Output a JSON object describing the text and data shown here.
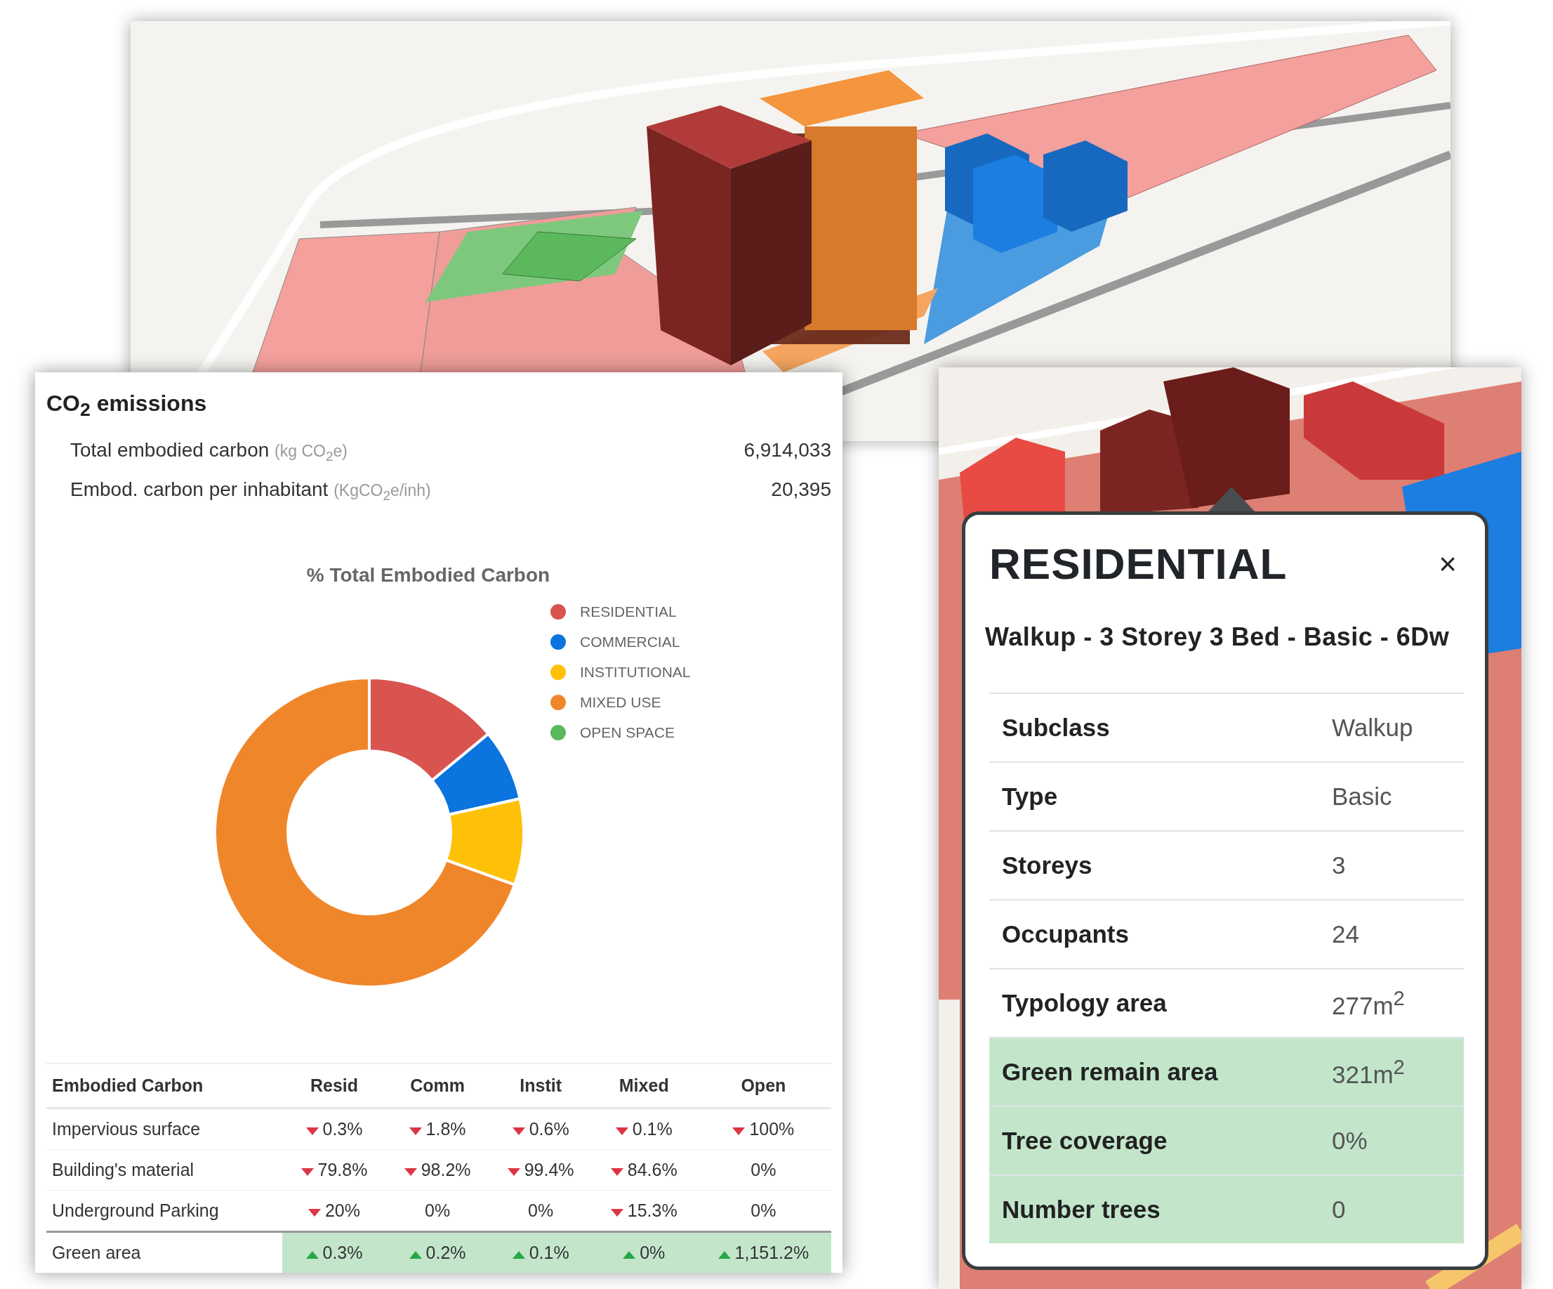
{
  "emissions_panel": {
    "title": "CO$_{2}$ emissions",
    "metrics": [
      {
        "label": "Total embodied carbon",
        "unit": "(kg CO$_{2}$e)",
        "value": "6,914,033"
      },
      {
        "label": "Embod. carbon per inhabitant",
        "unit": "(KgCO$_{2}$e/inh)",
        "value": "20,395"
      }
    ],
    "chart_title": "% Total Embodied Carbon",
    "legend": [
      {
        "label": "RESIDENTIAL",
        "color": "#d9534f"
      },
      {
        "label": "COMMERCIAL",
        "color": "#0b74de"
      },
      {
        "label": "INSTITUTIONAL",
        "color": "#ffc107"
      },
      {
        "label": "MIXED USE",
        "color": "#f0862a"
      },
      {
        "label": "OPEN SPACE",
        "color": "#5cb85c"
      }
    ],
    "table": {
      "columns": [
        "Embodied Carbon",
        "Resid",
        "Comm",
        "Instit",
        "Mixed",
        "Open"
      ],
      "rows": [
        {
          "highlight": false,
          "cells": [
            {
              "text": "Impervious surface"
            },
            {
              "text": "0.3%",
              "kind": "down"
            },
            {
              "text": "1.8%",
              "kind": "down"
            },
            {
              "text": "0.6%",
              "kind": "down"
            },
            {
              "text": "0.1%",
              "kind": "down"
            },
            {
              "text": "100%",
              "kind": "down"
            }
          ]
        },
        {
          "highlight": false,
          "cells": [
            {
              "text": "Building's material"
            },
            {
              "text": "79.8%",
              "kind": "down"
            },
            {
              "text": "98.2%",
              "kind": "down"
            },
            {
              "text": "99.4%",
              "kind": "down"
            },
            {
              "text": "84.6%",
              "kind": "down"
            },
            {
              "text": "0%",
              "kind": "plain"
            }
          ]
        },
        {
          "highlight": false,
          "cells": [
            {
              "text": "Underground Parking"
            },
            {
              "text": "20%",
              "kind": "down"
            },
            {
              "text": "0%",
              "kind": "plain"
            },
            {
              "text": "0%",
              "kind": "plain"
            },
            {
              "text": "15.3%",
              "kind": "down"
            },
            {
              "text": "0%",
              "kind": "plain"
            }
          ]
        },
        {
          "highlight": true,
          "cells": [
            {
              "text": "Green area"
            },
            {
              "text": "0.3%",
              "kind": "up"
            },
            {
              "text": "0.2%",
              "kind": "up"
            },
            {
              "text": "0.1%",
              "kind": "up"
            },
            {
              "text": "0%",
              "kind": "up"
            },
            {
              "text": "1,151.2%",
              "kind": "up"
            }
          ]
        }
      ]
    }
  },
  "popup": {
    "title": "RESIDENTIAL",
    "close": "×",
    "subtitle": "Walkup - 3 Storey 3 Bed - Basic - 6Dw",
    "rows": [
      {
        "label": "Subclass",
        "value": "Walkup",
        "highlight": false
      },
      {
        "label": "Type",
        "value": "Basic",
        "highlight": false
      },
      {
        "label": "Storeys",
        "value": "3",
        "highlight": false
      },
      {
        "label": "Occupants",
        "value": "24",
        "highlight": false
      },
      {
        "label": "Typology area",
        "value": "277m$^{2}$",
        "highlight": false
      },
      {
        "label": "Green remain area",
        "value": "321m$^{2}$",
        "highlight": true
      },
      {
        "label": "Tree coverage",
        "value": "0%",
        "highlight": true
      },
      {
        "label": "Number trees",
        "value": "0",
        "highlight": true
      }
    ]
  }
}
